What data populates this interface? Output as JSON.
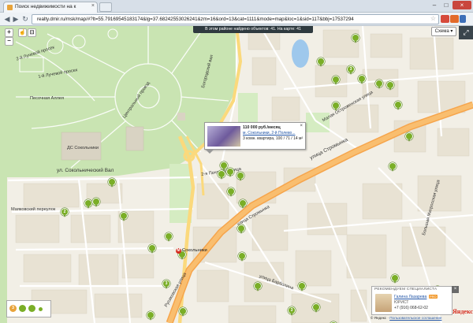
{
  "browser": {
    "tab_title": "Поиск недвижимости на к",
    "tab_close": "×",
    "new_tab": "",
    "url": "realty.dmir.ru/msk/map/#?lt=55.79169545183174&lg=37.68242553026241&zm=16&ord=13&cat=1111&mode=map&loc=1&sid=117&bbj=17537294",
    "back": "◀",
    "forward": "▶",
    "reload": "↻",
    "star": "☆",
    "window_buttons": [
      "–",
      "□",
      "×"
    ],
    "ext_colors": [
      "#d64a3b",
      "#e26b2b",
      "#3d6fb8",
      "#3b4e6b",
      "#cc3333"
    ]
  },
  "map": {
    "info_bar": "В этом районе найдено объектов: 41. На карте: 41",
    "scheme_label": "Схема ▾",
    "fullscreen": "⤢",
    "zoom_in": "+",
    "zoom_out": "−",
    "tool_1": "☝",
    "tool_2": "⊡",
    "metro_label": "Сокольники",
    "metro_symbol": "М",
    "street_labels": {
      "sokolnichesky_val": "ул. Сокольнический Вал",
      "stromynka": "улица Стромынка",
      "rusakovskaya": "Русаковская улица",
      "mayakovka": "Маяковский переулок",
      "tsentralny": "Центральный проезд",
      "pesochnaya": "Песочная Аллея",
      "luchevoy_1": "1-й Лучевой просек",
      "luchevoy_2": "2-й Лучевой просек",
      "poperechny": "Поперечный проезд",
      "bogorodsky": "Богородский вал",
      "ostrovskaya": "Малая Остроженская улица",
      "matrosskaya": "Большая Матросская улица",
      "pochtovaya": "2-я Почтовая улица",
      "barbolina": "улица Барболина",
      "nizhne": "Нижне-Красносельская",
      "ds": "ДС Сокольники"
    },
    "markers": [
      {
        "label": ""
      },
      {
        "label": ""
      },
      {
        "label": ""
      },
      {
        "label": ""
      },
      {
        "label": ""
      },
      {
        "label": ""
      },
      {
        "label": "3"
      },
      {
        "label": ""
      },
      {
        "label": ""
      },
      {
        "label": ""
      },
      {
        "label": ""
      },
      {
        "label": ""
      },
      {
        "label": ""
      },
      {
        "label": ""
      },
      {
        "label": ""
      },
      {
        "label": ""
      },
      {
        "label": ""
      },
      {
        "label": ""
      },
      {
        "label": ""
      },
      {
        "label": ""
      },
      {
        "label": ""
      },
      {
        "label": "3"
      },
      {
        "label": ""
      },
      {
        "label": "2"
      },
      {
        "label": ""
      },
      {
        "label": ""
      },
      {
        "label": ""
      },
      {
        "label": ""
      },
      {
        "label": ""
      },
      {
        "label": ""
      },
      {
        "label": ""
      },
      {
        "label": "3"
      },
      {
        "label": ""
      },
      {
        "label": ""
      },
      {
        "label": ""
      },
      {
        "label": ""
      },
      {
        "label": ""
      },
      {
        "label": ""
      }
    ]
  },
  "popup": {
    "price": "110 000 руб./месяц",
    "address": "м. Сокольники, 2-й Полево...",
    "desc": "3 комн. квартира, 100 / 71 / 14 м²",
    "close": "×"
  },
  "specialist": {
    "header": "РЕКОМЕНДУЕМ СПЕЦИАЛИСТА",
    "name": "Галина Лазарева",
    "badge": "PRO",
    "role": "ЮРИСТ",
    "phone": "+7 (916) 068-62-02",
    "close": "×"
  },
  "legend": {
    "items": [
      "3",
      "",
      "",
      ""
    ]
  },
  "footer": {
    "copyright": "© Яндекс",
    "terms": "Пользовательское соглашение",
    "logo": "Яндекс"
  },
  "colors": {
    "park": "#c9e4b2",
    "road_major": "#f6a54c",
    "road_minor": "#ffffff",
    "land": "#f2efe6",
    "block": "#e8e2d3",
    "water": "#9ec8ec",
    "marker": "#7aae27"
  }
}
